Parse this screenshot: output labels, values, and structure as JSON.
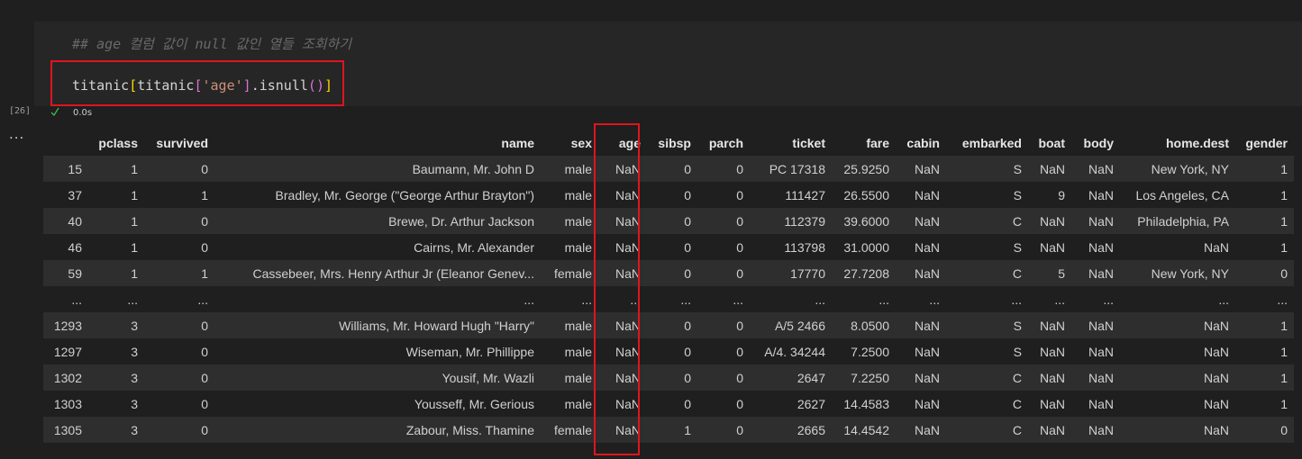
{
  "cell": {
    "comment": "## age 컬럼 값이 null 값인 열들 조회하기",
    "code_tokens": {
      "t1": "titanic",
      "b1_open": "[",
      "t2": "titanic",
      "b2_open": "[",
      "str": "'age'",
      "b2_close": "]",
      "method": ".isnull",
      "p_open": "(",
      "p_close": ")",
      "b1_close": "]"
    },
    "execution_count": "[26]",
    "exec_time": "0.0s",
    "output_menu": "..."
  },
  "table": {
    "columns": [
      "",
      "pclass",
      "survived",
      "name",
      "sex",
      "age",
      "sibsp",
      "parch",
      "ticket",
      "fare",
      "cabin",
      "embarked",
      "boat",
      "body",
      "home.dest",
      "gender"
    ],
    "rows": [
      [
        "15",
        "1",
        "0",
        "Baumann, Mr. John D",
        "male",
        "NaN",
        "0",
        "0",
        "PC 17318",
        "25.9250",
        "NaN",
        "S",
        "NaN",
        "NaN",
        "New York, NY",
        "1"
      ],
      [
        "37",
        "1",
        "1",
        "Bradley, Mr. George (\"George Arthur Brayton\")",
        "male",
        "NaN",
        "0",
        "0",
        "111427",
        "26.5500",
        "NaN",
        "S",
        "9",
        "NaN",
        "Los Angeles, CA",
        "1"
      ],
      [
        "40",
        "1",
        "0",
        "Brewe, Dr. Arthur Jackson",
        "male",
        "NaN",
        "0",
        "0",
        "112379",
        "39.6000",
        "NaN",
        "C",
        "NaN",
        "NaN",
        "Philadelphia, PA",
        "1"
      ],
      [
        "46",
        "1",
        "0",
        "Cairns, Mr. Alexander",
        "male",
        "NaN",
        "0",
        "0",
        "113798",
        "31.0000",
        "NaN",
        "S",
        "NaN",
        "NaN",
        "NaN",
        "1"
      ],
      [
        "59",
        "1",
        "1",
        "Cassebeer, Mrs. Henry Arthur Jr (Eleanor Genev...",
        "female",
        "NaN",
        "0",
        "0",
        "17770",
        "27.7208",
        "NaN",
        "C",
        "5",
        "NaN",
        "New York, NY",
        "0"
      ],
      [
        "...",
        "...",
        "...",
        "...",
        "...",
        "...",
        "...",
        "...",
        "...",
        "...",
        "...",
        "...",
        "...",
        "...",
        "...",
        "..."
      ],
      [
        "1293",
        "3",
        "0",
        "Williams, Mr. Howard Hugh \"Harry\"",
        "male",
        "NaN",
        "0",
        "0",
        "A/5 2466",
        "8.0500",
        "NaN",
        "S",
        "NaN",
        "NaN",
        "NaN",
        "1"
      ],
      [
        "1297",
        "3",
        "0",
        "Wiseman, Mr. Phillippe",
        "male",
        "NaN",
        "0",
        "0",
        "A/4. 34244",
        "7.2500",
        "NaN",
        "S",
        "NaN",
        "NaN",
        "NaN",
        "1"
      ],
      [
        "1302",
        "3",
        "0",
        "Yousif, Mr. Wazli",
        "male",
        "NaN",
        "0",
        "0",
        "2647",
        "7.2250",
        "NaN",
        "C",
        "NaN",
        "NaN",
        "NaN",
        "1"
      ],
      [
        "1303",
        "3",
        "0",
        "Yousseff, Mr. Gerious",
        "male",
        "NaN",
        "0",
        "0",
        "2627",
        "14.4583",
        "NaN",
        "C",
        "NaN",
        "NaN",
        "NaN",
        "1"
      ],
      [
        "1305",
        "3",
        "0",
        "Zabour, Miss. Thamine",
        "female",
        "NaN",
        "1",
        "0",
        "2665",
        "14.4542",
        "NaN",
        "C",
        "NaN",
        "NaN",
        "NaN",
        "0"
      ]
    ]
  },
  "colors": {
    "highlight_border": "#e0141e",
    "background": "#1f1f1f",
    "striped_row": "#2e2e2e",
    "success_check": "#3fb950"
  }
}
